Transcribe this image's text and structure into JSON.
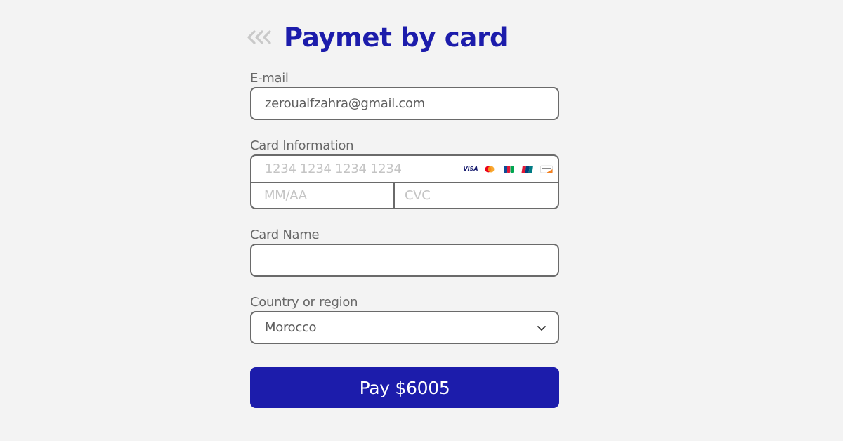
{
  "header": {
    "title": "Paymet by card",
    "back_icon": "triple-chevron-left-icon"
  },
  "email": {
    "label": "E-mail",
    "value": "zeroualfzahra@gmail.com"
  },
  "card": {
    "label": "Card Information",
    "number_placeholder": "1234 1234 1234 1234",
    "expiry_placeholder": "MM/AA",
    "cvc_placeholder": "CVC",
    "brands": [
      "VISA",
      "mastercard-icon",
      "jcb-icon",
      "unionpay-icon",
      "discover-icon"
    ]
  },
  "card_name": {
    "label": "Card Name",
    "value": ""
  },
  "country": {
    "label": "Country or region",
    "selected": "Morocco"
  },
  "pay_button": {
    "label": "Pay $6005"
  },
  "colors": {
    "accent": "#1c1cab",
    "background": "#f3f3f3",
    "border": "#6a6a6a",
    "label": "#686868",
    "placeholder": "#c4c4c4"
  }
}
